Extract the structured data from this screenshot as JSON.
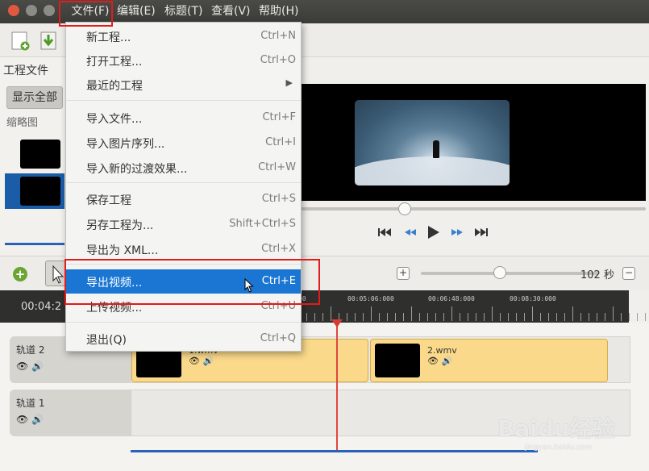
{
  "menubar": {
    "file": "文件(F)",
    "edit": "编辑(E)",
    "title": "标题(T)",
    "view": "查看(V)",
    "help": "帮助(H)"
  },
  "file_menu": {
    "items": [
      {
        "label": "新工程...",
        "accel": "Ctrl+N"
      },
      {
        "label": "打开工程...",
        "accel": "Ctrl+O"
      },
      {
        "label": "最近的工程",
        "accel": ""
      },
      {
        "label": "导入文件...",
        "accel": "Ctrl+F"
      },
      {
        "label": "导入图片序列...",
        "accel": "Ctrl+I"
      },
      {
        "label": "导入新的过渡效果...",
        "accel": "Ctrl+W"
      },
      {
        "label": "保存工程",
        "accel": "Ctrl+S"
      },
      {
        "label": "另存工程为...",
        "accel": "Shift+Ctrl+S"
      },
      {
        "label": "导出为 XML...",
        "accel": "Ctrl+X"
      },
      {
        "label": "导出视频...",
        "accel": "Ctrl+E"
      },
      {
        "label": "上传视频...",
        "accel": "Ctrl+U"
      },
      {
        "label": "退出(Q)",
        "accel": "Ctrl+Q"
      }
    ]
  },
  "left_panel": {
    "tab_project_files": "工程文件",
    "show_all": "显示全部",
    "filter_thumbnail": "缩略图"
  },
  "timeline_toolbar": {
    "zoom_value": "102 秒",
    "zoom_in_label": "+",
    "zoom_out_label": "−",
    "add_track_label": "+"
  },
  "ruler": {
    "current_time": "00:04:2",
    "ticks": [
      "00",
      "00:05:06:000",
      "00:06:48:000",
      "00:08:30:000"
    ]
  },
  "tracks": [
    {
      "name": "轨道 2",
      "icons": "👁 🔊"
    },
    {
      "name": "轨道 1",
      "icons": "👁 🔊"
    }
  ],
  "clips": [
    {
      "name": "1.wmv",
      "icons": "👁 🔊"
    },
    {
      "name": "2.wmv",
      "icons": "👁 🔊"
    }
  ],
  "watermark": {
    "logo": "Baidu经验",
    "url": "jingyan.baidu.com"
  },
  "colors": {
    "menu_highlight": "#1a76d2",
    "annotation_red": "#e21b1b",
    "clip_fill": "#fbd98a",
    "playhead": "#e0463f"
  }
}
